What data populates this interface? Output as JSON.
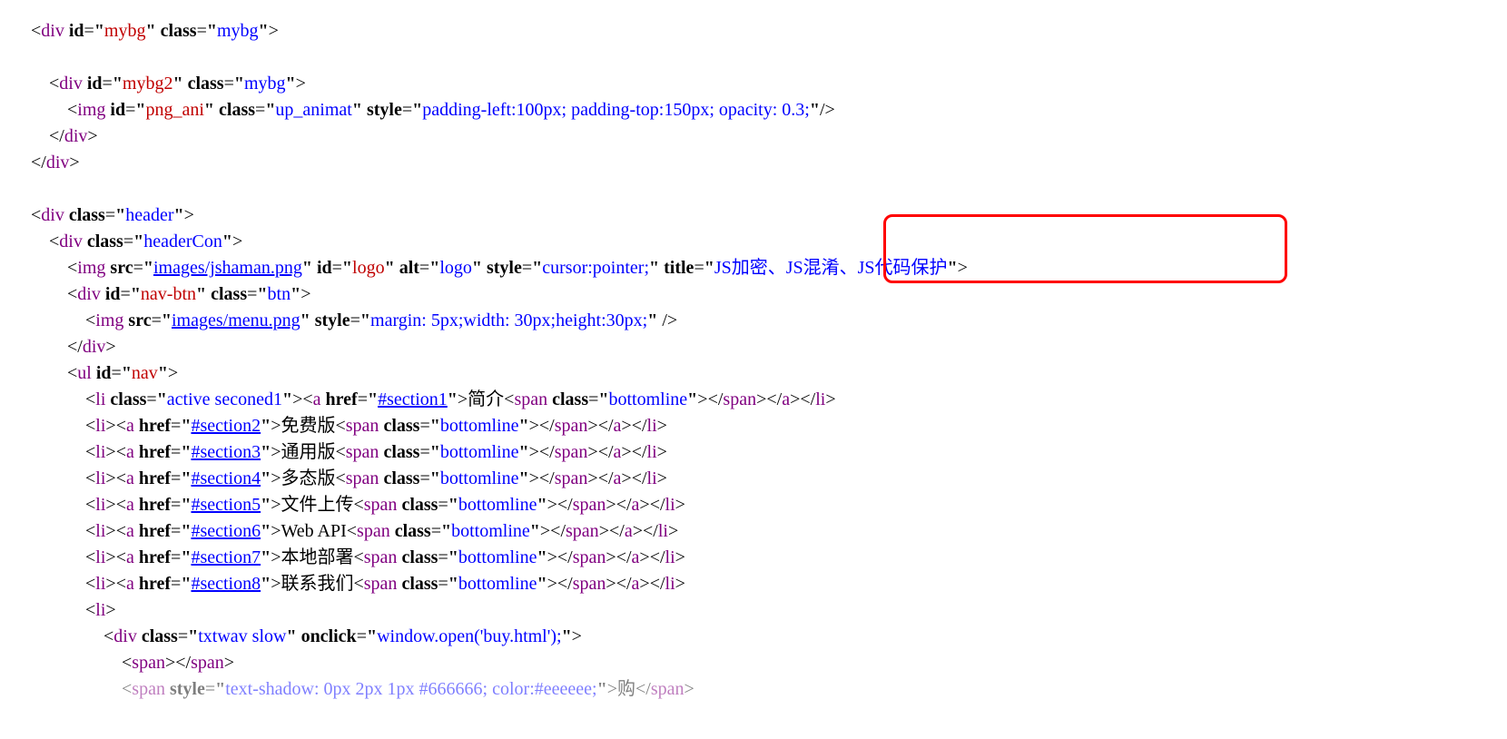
{
  "indent1": "    ",
  "indent2": "        ",
  "indent3": "            ",
  "indent4": "                ",
  "indent5": "                    ",
  "indent6": "                        ",
  "lt": "<",
  "gt": ">",
  "slash": "/",
  "eq": "=",
  "tags": {
    "div": "div",
    "img": "img",
    "ul": "ul",
    "li": "li",
    "a": "a",
    "span": "span"
  },
  "attrs": {
    "id": "id",
    "class": "class",
    "src": "src",
    "style": "style",
    "alt": "alt",
    "title": "title",
    "href": "href",
    "onclick": "onclick"
  },
  "l1": {
    "id": "mybg",
    "cls": "mybg"
  },
  "l2": {
    "id": "mybg2",
    "cls": "mybg"
  },
  "l3": {
    "id": "png_ani",
    "cls": "up_animat",
    "style": "padding-left:100px; padding-top:150px; opacity: 0.3;"
  },
  "l5": {
    "cls": "header"
  },
  "l6": {
    "cls": "headerCon"
  },
  "l7": {
    "src": "images/jshaman.png",
    "id": "logo",
    "alt": "logo",
    "style": "cursor:pointer;",
    "title": "JS加密、JS混淆、JS代码保护"
  },
  "l8": {
    "id": "nav-btn",
    "cls": "btn"
  },
  "l9": {
    "src": "images/menu.png",
    "style": "margin: 5px;width: 30px;height:30px;"
  },
  "l11": {
    "id": "nav"
  },
  "active_cls": "active seconed1",
  "bottomline": "bottomline",
  "nav1": {
    "href": "#section1",
    "txt": "简介"
  },
  "nav2": {
    "href": "#section2",
    "txt": "免费版"
  },
  "nav3": {
    "href": "#section3",
    "txt": "通用版"
  },
  "nav4": {
    "href": "#section4",
    "txt": "多态版"
  },
  "nav5": {
    "href": "#section5",
    "txt": "文件上传"
  },
  "nav6": {
    "href": "#section6",
    "txt": "Web API"
  },
  "nav7": {
    "href": "#section7",
    "txt": "本地部署"
  },
  "nav8": {
    "href": "#section8",
    "txt": "联系我们"
  },
  "txtwav_cls": "txtwav slow",
  "onclick_val": "window.open('buy.html');",
  "partial_style": "text-shadow: 0px 2px 1px #666666; color:#eeeeee;",
  "partial_text": "购"
}
